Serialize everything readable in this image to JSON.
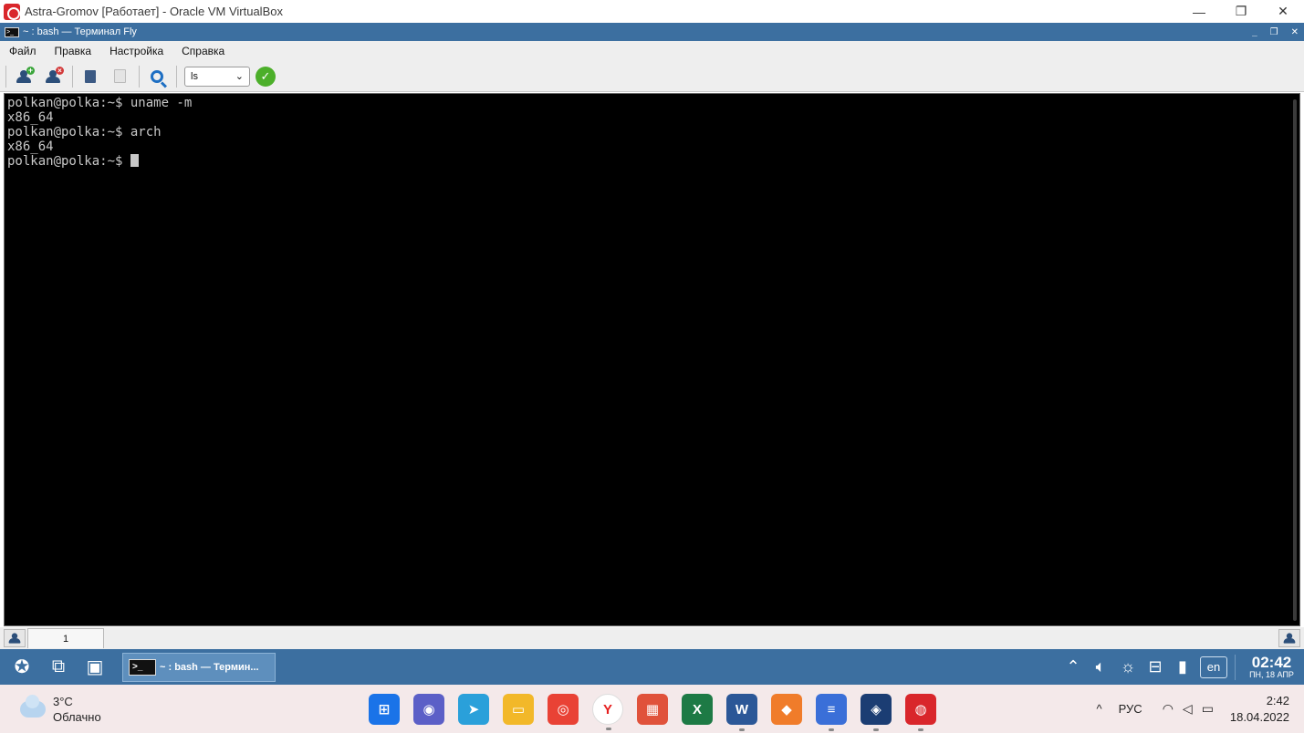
{
  "vbox": {
    "title": "Astra-Gromov [Работает] - Oracle VM VirtualBox",
    "minimize": "—",
    "restore": "❐",
    "close": "✕"
  },
  "fly_window": {
    "title": "~ : bash — Терминал Fly",
    "icon_text": ">_",
    "minimize": "_",
    "restore": "❐",
    "close": "✕"
  },
  "menu": {
    "file": "Файл",
    "edit": "Правка",
    "settings": "Настройка",
    "help": "Справка"
  },
  "toolbar": {
    "command_value": "ls",
    "icons": [
      "user-add-icon",
      "user-remove-icon",
      "copy-icon",
      "paste-icon",
      "search-icon",
      "run-check-icon"
    ]
  },
  "terminal": {
    "lines": [
      "polkan@polka:~$ uname -m",
      "x86_64",
      "polkan@polka:~$ arch",
      "x86_64",
      "polkan@polka:~$ "
    ]
  },
  "tabs": {
    "items": [
      "1"
    ]
  },
  "fly_panel": {
    "task_label": "~ : bash — Термин...",
    "task_icon_text": ">_",
    "lang": "en",
    "time": "02:42",
    "date": "ПН, 18 АПР"
  },
  "win_taskbar": {
    "temperature": "3°C",
    "weather": "Облачно",
    "tray_caret": "^",
    "lang": "РУС",
    "time": "2:42",
    "date": "18.04.2022",
    "apps": [
      {
        "name": "windows-start-icon",
        "color": "#1a73e8",
        "glyph": "⊞"
      },
      {
        "name": "teams-chat-icon",
        "color": "#5b5fc7",
        "glyph": "◉"
      },
      {
        "name": "telegram-icon",
        "color": "#2aa0da",
        "glyph": "➤"
      },
      {
        "name": "file-explorer-icon",
        "color": "#f2b829",
        "glyph": "▭"
      },
      {
        "name": "chrome-icon",
        "color": "#e94235",
        "glyph": "◎"
      },
      {
        "name": "yandex-browser-icon",
        "color": "#ffffff",
        "glyph": "Y"
      },
      {
        "name": "red-app-icon",
        "color": "#e0523b",
        "glyph": "▦"
      },
      {
        "name": "excel-icon",
        "color": "#1d7a45",
        "glyph": "X"
      },
      {
        "name": "word-icon",
        "color": "#2b5797",
        "glyph": "W"
      },
      {
        "name": "orange-app-icon",
        "color": "#f07c2a",
        "glyph": "◆"
      },
      {
        "name": "notepad-icon",
        "color": "#3a6fd8",
        "glyph": "≡"
      },
      {
        "name": "virtualbox-icon",
        "color": "#1b3d73",
        "glyph": "◈"
      },
      {
        "name": "astra-vm-icon",
        "color": "#d9262b",
        "glyph": "◍"
      }
    ]
  }
}
